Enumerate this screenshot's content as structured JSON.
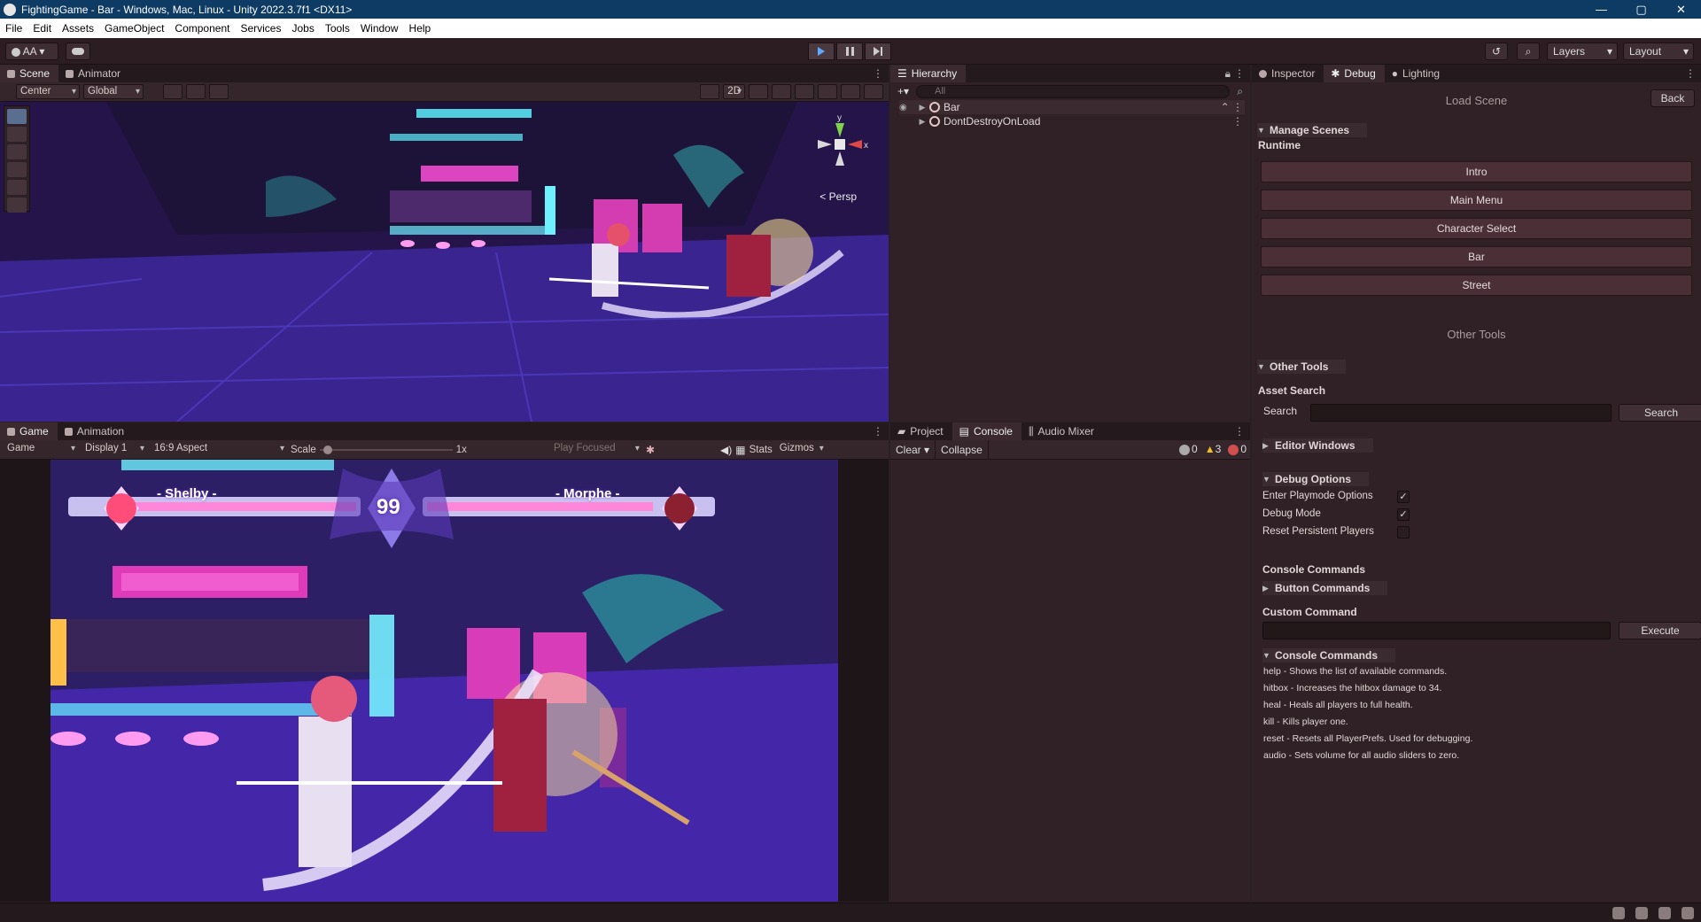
{
  "window": {
    "title": "FightingGame - Bar - Windows, Mac, Linux - Unity 2022.3.7f1 <DX11>",
    "min": "—",
    "max": "▢",
    "close": "✕"
  },
  "menu": [
    "File",
    "Edit",
    "Assets",
    "GameObject",
    "Component",
    "Services",
    "Jobs",
    "Tools",
    "Window",
    "Help"
  ],
  "toolbar": {
    "account": "AA",
    "layers": "Layers",
    "layout": "Layout"
  },
  "scene_panel": {
    "tabs": [
      "Scene",
      "Animator"
    ],
    "pivot": "Center",
    "space": "Global",
    "mode_2d": "2D",
    "persp": "Persp",
    "gizmo_y": "y",
    "gizmo_x": "x"
  },
  "game_panel": {
    "tabs": [
      "Game",
      "Animation"
    ],
    "view": "Game",
    "display": "Display 1",
    "aspect": "16:9 Aspect",
    "scale_label": "Scale",
    "scale_value": "1x",
    "play_focused": "Play Focused",
    "stats": "Stats",
    "gizmos": "Gizmos",
    "hud": {
      "player1": "- Shelby -",
      "player2": "- Morphe -",
      "timer": "99"
    }
  },
  "hierarchy": {
    "tab": "Hierarchy",
    "search_placeholder": "All",
    "items": [
      "Bar",
      "DontDestroyOnLoad"
    ]
  },
  "console": {
    "tabs": [
      "Project",
      "Console",
      "Audio Mixer"
    ],
    "clear": "Clear",
    "collapse": "Collapse",
    "log_count": "0",
    "warn_count": "3",
    "error_count": "0"
  },
  "inspector": {
    "tabs": [
      "Inspector",
      "Debug",
      "Lighting"
    ],
    "load_scene": "Load Scene",
    "back": "Back",
    "manage_scenes": "Manage Scenes",
    "runtime": "Runtime",
    "scenes": [
      "Intro",
      "Main Menu",
      "Character Select",
      "Bar",
      "Street"
    ],
    "other_tools_title": "Other Tools",
    "other_tools": "Other Tools",
    "asset_search": "Asset Search",
    "search_label": "Search",
    "search_button": "Search",
    "editor_windows": "Editor Windows",
    "debug_options": "Debug Options",
    "options": [
      {
        "label": "Enter Playmode Options",
        "checked": "✓"
      },
      {
        "label": "Debug Mode",
        "checked": "✓"
      },
      {
        "label": "Reset Persistent Players",
        "checked": ""
      }
    ],
    "console_commands_label": "Console Commands",
    "button_commands": "Button Commands",
    "custom_command": "Custom Command",
    "execute": "Execute",
    "console_commands_foldout": "Console Commands",
    "commands": [
      "help - Shows the list of available commands.",
      "hitbox - Increases the hitbox damage to 34.",
      "heal - Heals all players to full health.",
      "kill - Kills player one.",
      "reset - Resets all PlayerPrefs. Used for debugging.",
      "audio - Sets volume for all audio sliders to zero."
    ]
  }
}
